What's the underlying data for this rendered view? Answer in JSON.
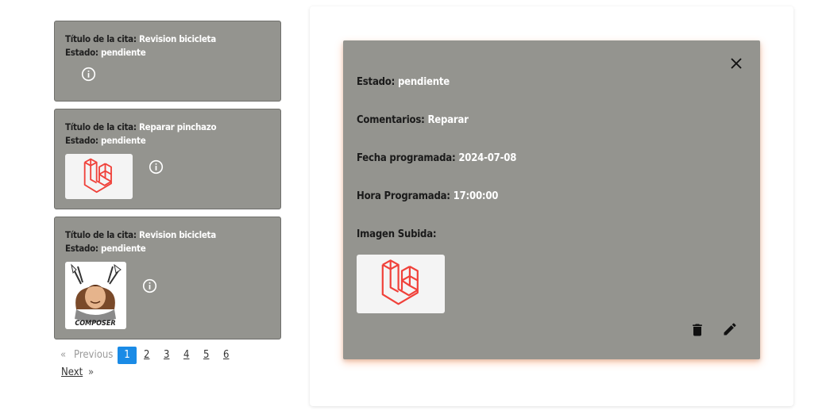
{
  "cards": [
    {
      "title_label": "Título de la cita:",
      "title_value": "Revision bicicleta",
      "status_label": "Estado:",
      "status_value": "pendiente",
      "image": "none"
    },
    {
      "title_label": "Título de la cita:",
      "title_value": "Reparar pinchazo",
      "status_label": "Estado:",
      "status_value": "pendiente",
      "image": "laravel-logo"
    },
    {
      "title_label": "Título de la cita:",
      "title_value": "Revision bicicleta",
      "status_label": "Estado:",
      "status_value": "pendiente",
      "image": "composer-logo"
    }
  ],
  "composer_logo_text": "COMPOSER",
  "pagination": {
    "prev_arrow": "«",
    "previous": "Previous",
    "pages": [
      "1",
      "2",
      "3",
      "4",
      "5",
      "6"
    ],
    "current": "1",
    "next": "Next",
    "next_arrow": "»"
  },
  "detail": {
    "status_label": "Estado:",
    "status_value": "pendiente",
    "comments_label": "Comentarios:",
    "comments_value": "Reparar",
    "date_label": "Fecha programada:",
    "date_value": "2024-07-08",
    "time_label": "Hora Programada:",
    "time_value": "17:00:00",
    "image_label": "Imagen Subida:"
  },
  "icons": {
    "info": "info-icon",
    "close": "close-icon",
    "delete": "trash-icon",
    "edit": "pencil-icon"
  },
  "colors": {
    "card_bg": "#94948f",
    "pager_active": "#1a8be6",
    "laravel_red": "#f0413a"
  }
}
